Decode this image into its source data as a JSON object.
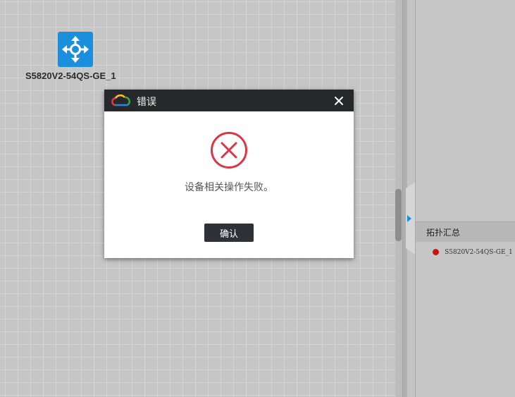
{
  "canvas": {
    "device": {
      "icon": "switch-arrows-icon",
      "label": "S5820V2-54QS-GE_1",
      "color": "#1b8fdc"
    }
  },
  "right_panel": {
    "summary_title": "拓扑汇总",
    "items": [
      {
        "label": "S5820V2-54QS-GE_1",
        "status_color": "#cc1010"
      }
    ]
  },
  "dialog": {
    "title": "错误",
    "logo_icon": "cloud-logo-icon",
    "close_icon": "close-icon",
    "error_icon": "error-x-icon",
    "error_color": "#dc3545",
    "message": "设备相关操作失败。",
    "ok_label": "确认"
  }
}
